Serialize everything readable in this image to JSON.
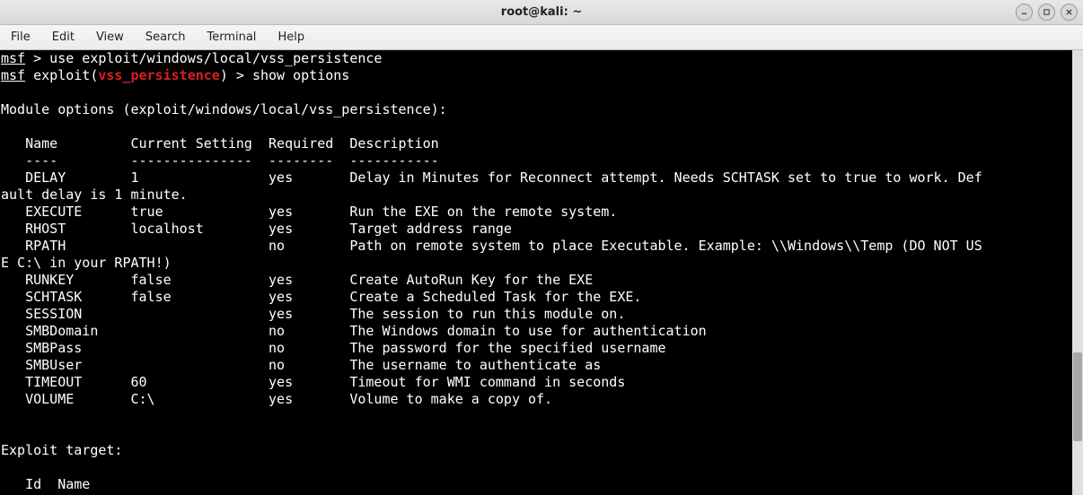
{
  "window": {
    "title": "root@kali: ~"
  },
  "menu": {
    "items": [
      "File",
      "Edit",
      "View",
      "Search",
      "Terminal",
      "Help"
    ]
  },
  "prompt": {
    "msf": "msf",
    "arrow": ">",
    "use_cmd": "use exploit/windows/local/vss_persistence",
    "exploit_label": "exploit(",
    "exploit_name": "vss_persistence",
    "exploit_close": ")",
    "show_cmd": "show options"
  },
  "module": {
    "header": "Module options (exploit/windows/local/vss_persistence):",
    "cols": {
      "name": "Name",
      "setting": "Current Setting",
      "required": "Required",
      "desc": "Description"
    },
    "sep": {
      "name": "----",
      "setting": "---------------",
      "required": "--------",
      "desc": "-----------"
    },
    "opts": [
      {
        "name": "DELAY",
        "setting": "1",
        "required": "yes",
        "desc": "Delay in Minutes for Reconnect attempt. Needs SCHTASK set to true to work. Def"
      },
      {
        "name": "EXECUTE",
        "setting": "true",
        "required": "yes",
        "desc": "Run the EXE on the remote system."
      },
      {
        "name": "RHOST",
        "setting": "localhost",
        "required": "yes",
        "desc": "Target address range"
      },
      {
        "name": "RPATH",
        "setting": "",
        "required": "no",
        "desc": "Path on remote system to place Executable. Example: \\\\Windows\\\\Temp (DO NOT US"
      },
      {
        "name": "RUNKEY",
        "setting": "false",
        "required": "yes",
        "desc": "Create AutoRun Key for the EXE"
      },
      {
        "name": "SCHTASK",
        "setting": "false",
        "required": "yes",
        "desc": "Create a Scheduled Task for the EXE."
      },
      {
        "name": "SESSION",
        "setting": "",
        "required": "yes",
        "desc": "The session to run this module on."
      },
      {
        "name": "SMBDomain",
        "setting": "",
        "required": "no",
        "desc": "The Windows domain to use for authentication"
      },
      {
        "name": "SMBPass",
        "setting": "",
        "required": "no",
        "desc": "The password for the specified username"
      },
      {
        "name": "SMBUser",
        "setting": "",
        "required": "no",
        "desc": "The username to authenticate as"
      },
      {
        "name": "TIMEOUT",
        "setting": "60",
        "required": "yes",
        "desc": "Timeout for WMI command in seconds"
      },
      {
        "name": "VOLUME",
        "setting": "C:\\",
        "required": "yes",
        "desc": "Volume to make a copy of."
      }
    ],
    "wrap1": "ault delay is 1 minute.",
    "wrap2": "E C:\\ in your RPATH!)"
  },
  "target": {
    "header": "Exploit target:",
    "cols": "   Id  Name"
  }
}
